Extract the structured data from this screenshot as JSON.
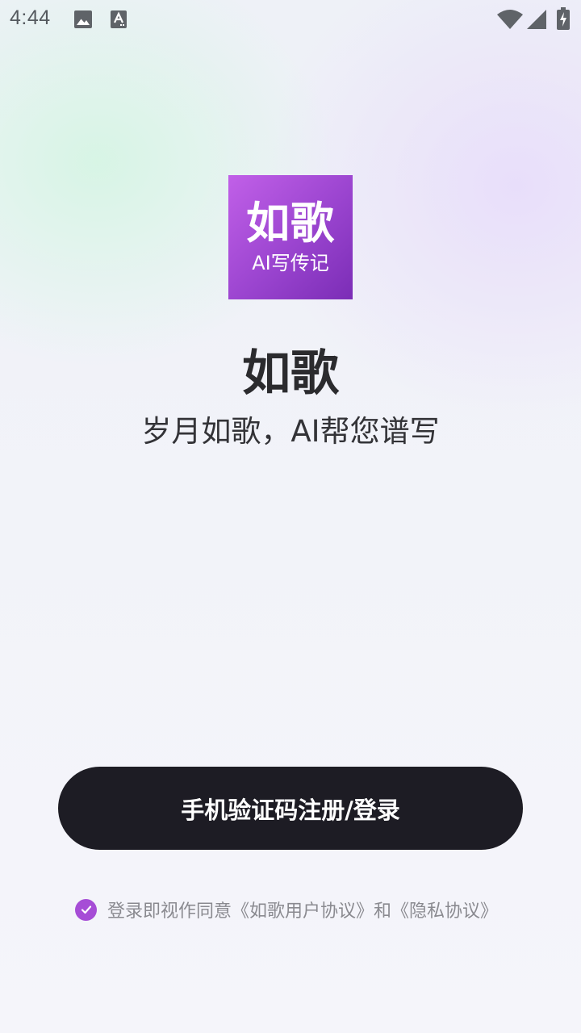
{
  "status_bar": {
    "time": "4:44",
    "left_icons": [
      "image-icon",
      "font-icon"
    ],
    "right_icons": [
      "wifi-icon",
      "signal-icon",
      "battery-icon"
    ]
  },
  "logo": {
    "main_text": "如歌",
    "sub_text": "AI写传记",
    "gradient_colors": [
      "#c160e8",
      "#9a44cf",
      "#7b2db6"
    ]
  },
  "app": {
    "name": "如歌",
    "slogan": "岁月如歌，AI帮您谱写"
  },
  "login_button": {
    "label": "手机验证码注册/登录",
    "background_color": "#1d1c24"
  },
  "agreement": {
    "checked": true,
    "prefix": "登录即视作同意",
    "user_agreement": "《如歌用户协议》",
    "conjunction": "和",
    "privacy_policy": "《隐私协议》",
    "check_color": "#a64dd6"
  }
}
